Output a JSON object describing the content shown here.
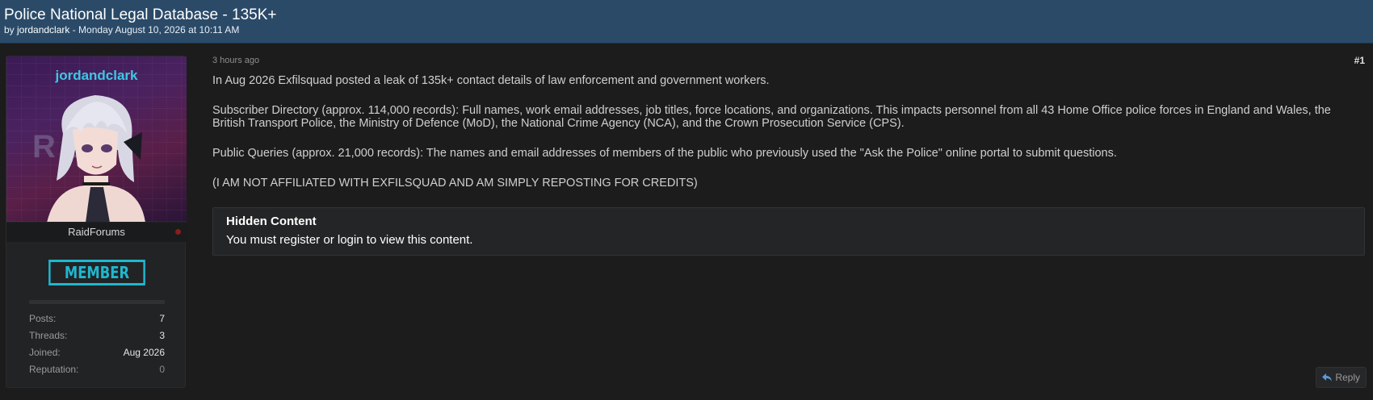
{
  "thread": {
    "title": "Police National Legal Database - 135K+",
    "by_prefix": "by ",
    "author": "jordandclark",
    "date_text": " - Monday August 10, 2026 at 10:11 AM"
  },
  "user": {
    "username": "jordandclark",
    "avatar_text": "R      s",
    "forum_name": "RaidForums",
    "rank": "MEMBER",
    "stats": [
      {
        "label": "Posts:",
        "value": "7"
      },
      {
        "label": "Threads:",
        "value": "3"
      },
      {
        "label": "Joined:",
        "value": "Aug 2026"
      },
      {
        "label": "Reputation:",
        "value": "0"
      }
    ]
  },
  "post": {
    "time": "3 hours ago",
    "number": "#1",
    "paragraphs": [
      "In Aug 2026 Exfilsquad posted a leak of 135k+ contact details of law enforcement and government workers.",
      "Subscriber Directory (approx. 114,000 records): Full names, work email addresses, job titles, force locations, and organizations. This impacts personnel from all 43 Home Office police forces in England and Wales, the British Transport Police, the Ministry of Defence (MoD), the National Crime Agency (NCA), and the Crown Prosecution Service (CPS).",
      "Public Queries (approx. 21,000 records): The names and email addresses of members of the public who previously used the \"Ask the Police\" online portal to submit questions.",
      "(I AM NOT AFFILIATED WITH EXFILSQUAD AND AM SIMPLY REPOSTING FOR CREDITS)"
    ],
    "hidden": {
      "title": "Hidden Content",
      "text_1": "You must ",
      "register": "register",
      "text_2": " or ",
      "login": "login",
      "text_3": " to view this content."
    }
  },
  "actions": {
    "reply_label": "Reply"
  },
  "colors": {
    "header_bg": "#2a4a68",
    "username": "#3cc8e6",
    "rank": "#1fb7cf",
    "status_offline": "#8a1d1d"
  }
}
